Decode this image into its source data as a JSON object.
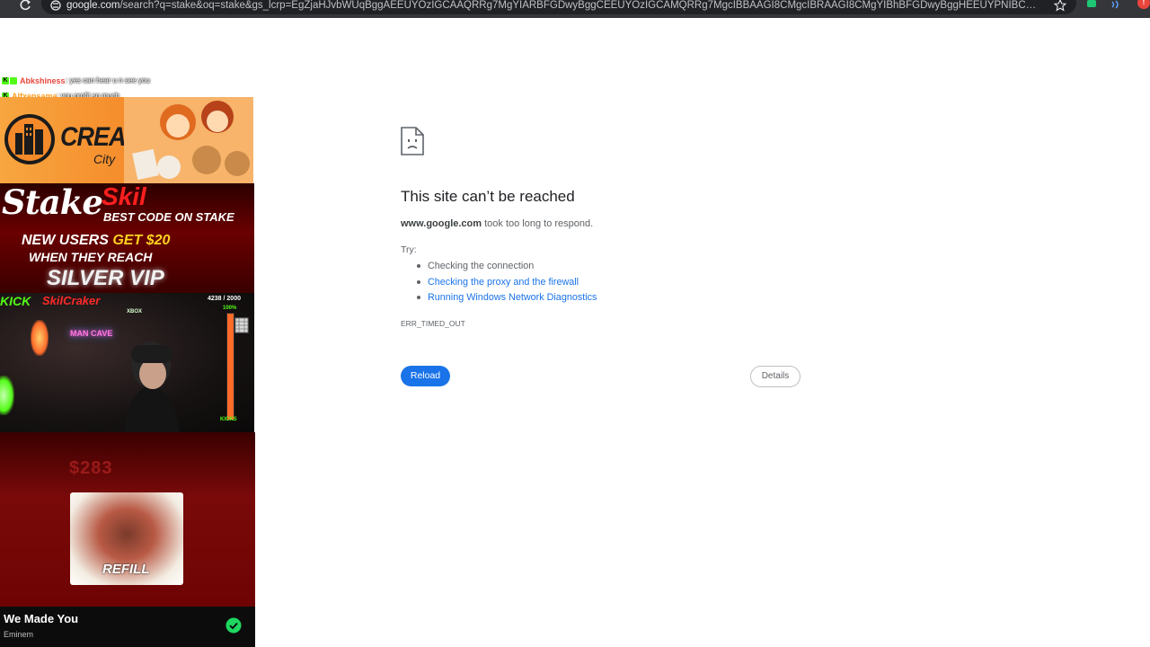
{
  "browser": {
    "url_host": "google.com",
    "url_rest": "/search?q=stake&oq=stake&gs_lcrp=EgZjaHJvbWUqBggAEEUYOzIGCAAQRRg7MgYIARBFGDwyBggCEEUYOzIGCAMQRRg7MgcIBBAAGI8CMgcIBRAAGI8CMgYIBhBFGDwyBggHEEUYPNIBCTQxMDVqMGoxNagCCLACAfEF623Ij..."
  },
  "error_page": {
    "title": "This site can’t be reached",
    "host": "www.google.com",
    "message": " took too long to respond.",
    "try_label": "Try:",
    "suggestions": [
      "Checking the connection",
      "Checking the proxy and the firewall",
      "Running Windows Network Diagnostics"
    ],
    "error_code": "ERR_TIMED_OUT",
    "reload_label": "Reload",
    "details_label": "Details"
  },
  "overlay": {
    "chat": [
      {
        "name": "Abkshiness",
        "message": ": yes can hear u n see you",
        "name_color": "#e8453c"
      },
      {
        "name": "Alfxensama",
        "message": ": you profit so much",
        "name_color": "#ff9e1f"
      }
    ],
    "creative_city": {
      "title": "CREATIVE",
      "subtitle": "City"
    },
    "stake_promo": {
      "stake": "Stake",
      "skil": "Skil",
      "best_code": "BEST CODE ON STAKE",
      "new_users": "NEW USERS ",
      "get_amount": "GET $20",
      "when_reach": "WHEN THEY REACH",
      "silver_vip": "SILVER VIP"
    },
    "webcam": {
      "kick": "KICK",
      "streamer": "SkilCraker",
      "kicks_count": "4238 / 2000",
      "goal_pct": "100%",
      "kicks_label": "KICKS",
      "neon_sign": "MAN CAVE",
      "xbox_sign": "XBOX",
      "goal_progress": 1.0
    },
    "music": {
      "amount": "$283",
      "album_text": "REFILL",
      "song_title": "We Made You",
      "artist": "Eminem"
    }
  }
}
